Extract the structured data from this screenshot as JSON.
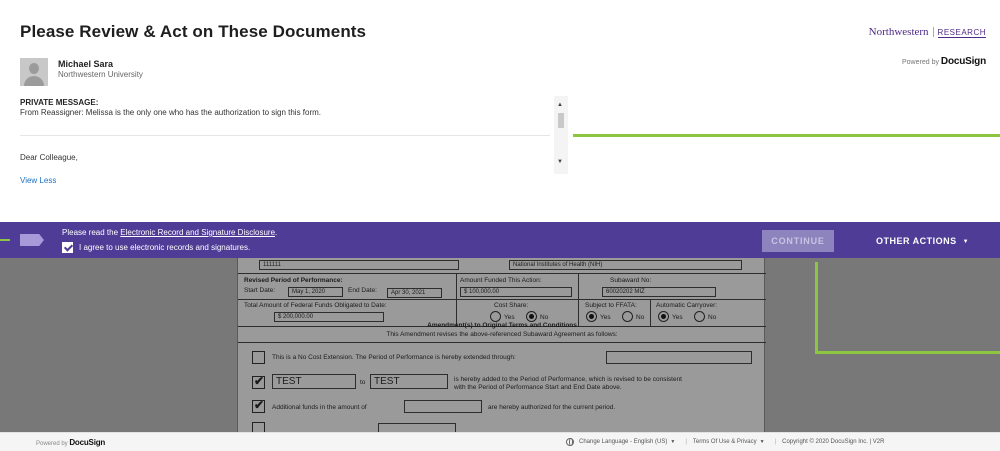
{
  "header": {
    "title": "Please Review & Act on These Documents",
    "brand": {
      "name": "Northwestern",
      "sub": "RESEARCH"
    },
    "powered_by": {
      "prefix": "Powered by",
      "name": "DocuSign"
    }
  },
  "sender": {
    "name": "Michael Sara",
    "organization": "Northwestern University"
  },
  "message": {
    "label": "PRIVATE MESSAGE:",
    "text": "From Reassigner: Melissa is the only one who has the authorization to sign this form.",
    "greeting": "Dear Colleague,",
    "view_less": "View Less"
  },
  "action_bar": {
    "disclosure_prefix": "Please read the",
    "disclosure_link": "Electronic Record and Signature Disclosure",
    "disclosure_suffix": ".",
    "agree_label": "I agree to use electronic records and signatures.",
    "agree_checked": true,
    "continue_label": "CONTINUE",
    "other_actions_label": "OTHER ACTIONS"
  },
  "document": {
    "top_left_value": "111111",
    "top_right_value": "National Institutes of Health (NIH)",
    "revised_period_label": "Revised Period of Performance:",
    "start_date_label": "Start Date:",
    "start_date": "May 1, 2020",
    "end_date_label": "End Date:",
    "end_date": "Apr 30, 2021",
    "amount_funded_label": "Amount Funded This Action:",
    "amount_funded": "$ 100,000.00",
    "subaward_no_label": "Subaward No:",
    "subaward_no": "60020202 MIZ",
    "total_federal_label": "Total Amount of Federal Funds Obligated to Date:",
    "total_federal": "$ 200,000.00",
    "cost_share_label": "Cost Share:",
    "ffata_label": "Subject to FFATA:",
    "carryover_label": "Automatic Carryover:",
    "yes": "Yes",
    "no": "No",
    "amend_title": "Amendment(s) to Original Terms and Conditions",
    "amend_sub": "This Amendment revises the above-referenced Subaward Agreement as follows:",
    "nce_text": "This is a No Cost Extension. The Period of Performance is hereby extended through:",
    "test_1": "TEST",
    "to_label": "to",
    "test_2": "TEST",
    "added_text_1": "is hereby added to the Period of Performance, which is revised to be consistent",
    "added_text_2": "with the Period of Performance Start and End Date above.",
    "funds_text_1": "Additional funds in the amount of",
    "funds_text_2": "are hereby authorized for the current period."
  },
  "footer": {
    "powered_by_prefix": "Powered by",
    "powered_by_name": "DocuSign",
    "change_language": "Change Language - English (US)",
    "terms": "Terms Of Use & Privacy",
    "copyright": "Copyright © 2020 DocuSign Inc. | V2R"
  },
  "colors": {
    "action_bar": "#4e3c96",
    "accent_green": "#8cc63f",
    "link": "#1f6fc0",
    "brand_purple": "#4e2a84"
  }
}
